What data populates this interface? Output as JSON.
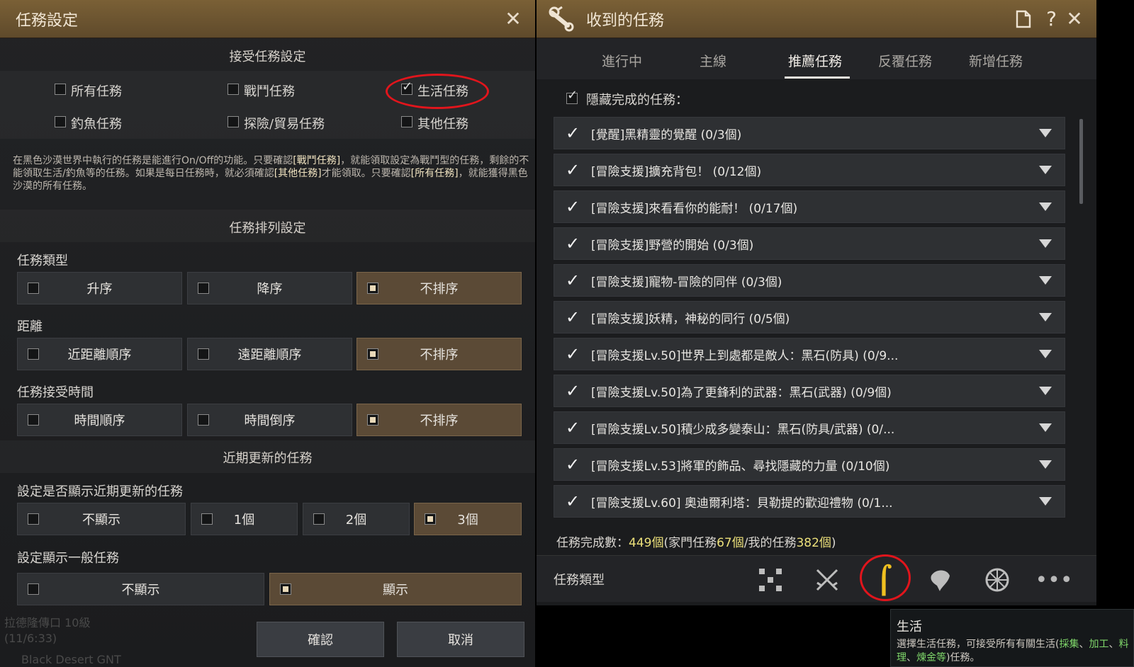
{
  "left": {
    "title": "任務設定",
    "accept_header": "接受任務設定",
    "accept_options": [
      {
        "label": "所有任務",
        "checked": false
      },
      {
        "label": "戰鬥任務",
        "checked": false
      },
      {
        "label": "生活任務",
        "checked": true
      },
      {
        "label": "釣魚任務",
        "checked": false
      },
      {
        "label": "探險/貿易任務",
        "checked": false
      },
      {
        "label": "其他任務",
        "checked": false
      }
    ],
    "desc": {
      "p1": "在黑色沙漠世界中執行的任務是能進行On/Off的功能。只要確認",
      "k1": "[戰鬥任務]",
      "p2": "，就能領取設定為戰鬥型的任務，剩餘的不能領取生活/釣魚等的任務。如果是每日任務時，就必須確認",
      "k2": "[其他任務]",
      "p3": "才能領取。只要確認",
      "k3": "[所有任務]",
      "p4": "，就能獲得黑色沙漠的所有任務。"
    },
    "sort_header": "任務排列設定",
    "type_label": "任務類型",
    "type_opts": [
      "升序",
      "降序",
      "不排序"
    ],
    "dist_label": "距離",
    "dist_opts": [
      "近距離順序",
      "遠距離順序",
      "不排序"
    ],
    "time_label": "任務接受時間",
    "time_opts": [
      "時間順序",
      "時間倒序",
      "不排序"
    ],
    "recent_header": "近期更新的任務",
    "recent_label": "設定是否顯示近期更新的任務",
    "recent_opts": [
      "不顯示",
      "1個",
      "2個",
      "3個"
    ],
    "normal_label": "設定顯示一般任務",
    "normal_opts": [
      "不顯示",
      "顯示"
    ],
    "confirm": "確認",
    "cancel": "取消",
    "ghost1": "拉德隆傳口 10級",
    "ghost2": "(11/6:33)",
    "ghost3": "Black Desert GNT"
  },
  "right": {
    "title": "收到的任務",
    "icons": [
      "scroll-icon",
      "document-icon",
      "help-icon",
      "close-icon"
    ],
    "tabs": [
      "進行中",
      "主線",
      "推薦任務",
      "反覆任務",
      "新增任務"
    ],
    "active_tab": "推薦任務",
    "hide_completed": "隱藏完成的任務：",
    "quests": [
      {
        "name": "[覺醒]黑精靈的覺醒",
        "count": "(0/3個)"
      },
      {
        "name": "[冒險支援]擴充背包！",
        "count": "(0/12個)"
      },
      {
        "name": "[冒險支援]來看看你的能耐！",
        "count": "(0/17個)"
      },
      {
        "name": "[冒險支援]野營的開始",
        "count": "(0/3個)"
      },
      {
        "name": "[冒險支援]寵物-冒險的同伴",
        "count": "(0/3個)"
      },
      {
        "name": "[冒險支援]妖精，神秘的同行",
        "count": "(0/5個)"
      },
      {
        "name": "[冒險支援Lv.50]世界上到處都是敵人：黑石(防具)",
        "count": "(0/9..."
      },
      {
        "name": "[冒險支援Lv.50]為了更鋒利的武器：黑石(武器)",
        "count": "(0/9個)"
      },
      {
        "name": "[冒險支援Lv.50]積少成多變泰山：黑石(防具/武器)",
        "count": "(0/..."
      },
      {
        "name": "[冒險支援Lv.53]將軍的飾品、尋找隱藏的力量",
        "count": "(0/10個)"
      },
      {
        "name": "[冒險支援Lv.60] 奧迪爾利塔：貝勒提的歡迎禮物",
        "count": "(0/1..."
      }
    ],
    "completion": {
      "pre": "任務完成數：",
      "total": "449個",
      "mid1": "(家門任務",
      "family": "67個",
      "mid2": "/我的任務",
      "mine": "382個",
      "end": ")"
    },
    "footer_label": "任務類型",
    "footer_icons": [
      "all-types-icon",
      "combat-icon",
      "life-icon",
      "fishing-icon",
      "explore-icon",
      "more-icon"
    ]
  },
  "tooltip": {
    "title": "生活",
    "t1": "選擇生活任務，可接受所有有關生活(",
    "k1": "採集",
    "s1": "、",
    "k2": "加工",
    "s2": "、",
    "k3": "料理",
    "s3": "、",
    "k4": "煉金等",
    "t2": ")任務。"
  }
}
